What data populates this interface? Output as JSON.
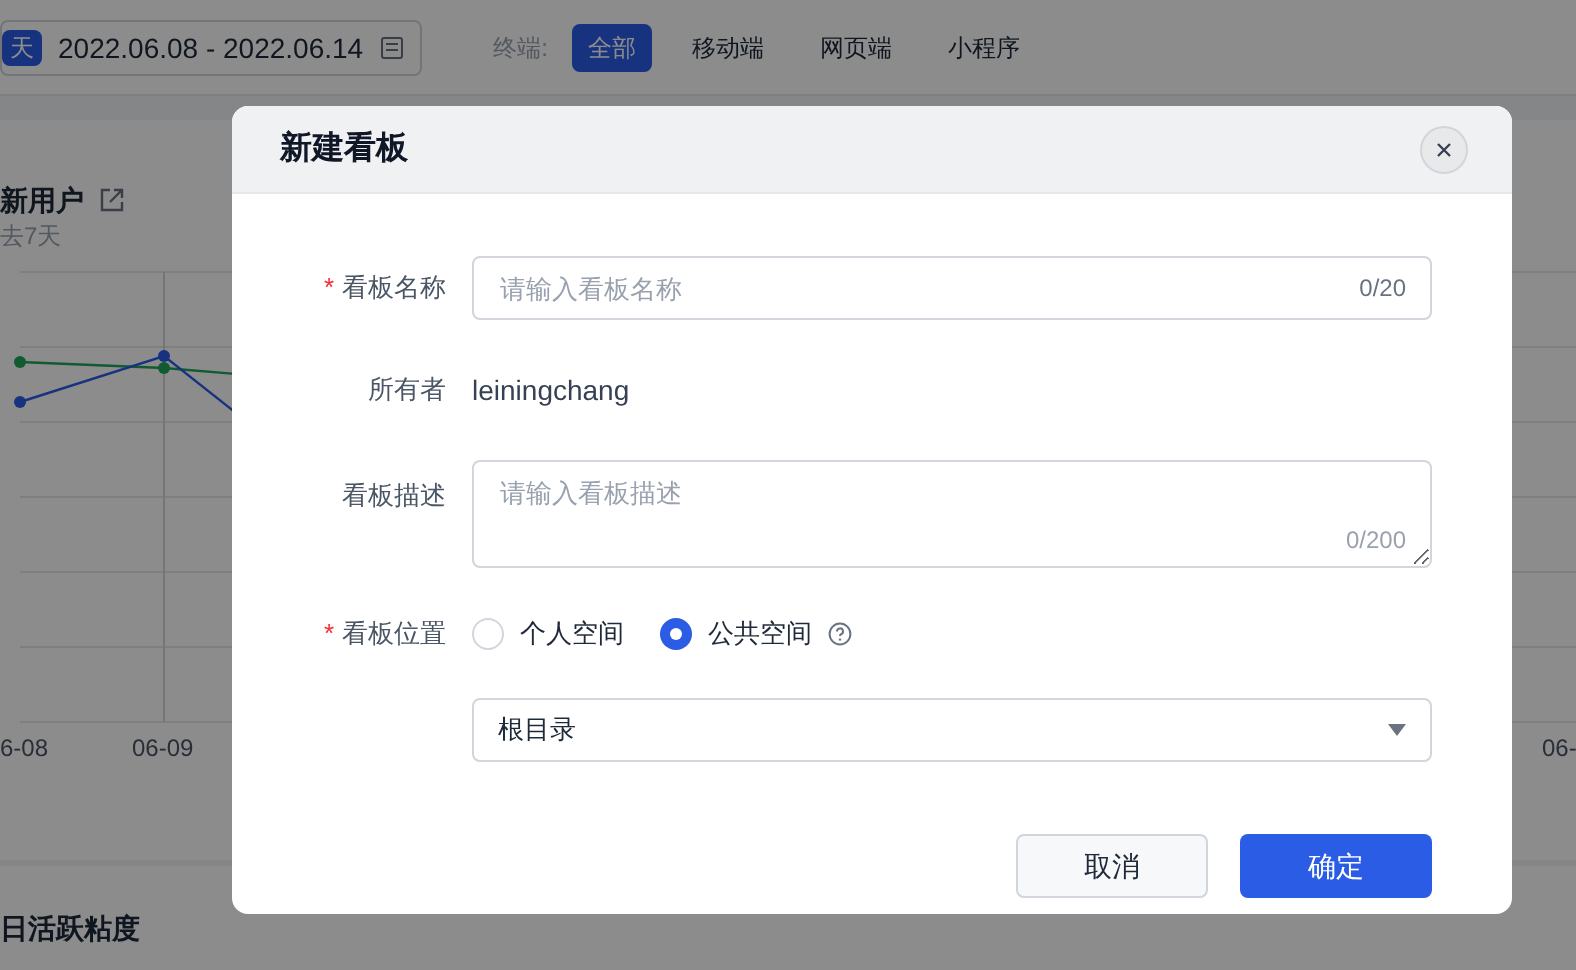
{
  "background": {
    "range_tag": "天",
    "date_range": "2022.06.08 - 2022.06.14",
    "terminal_label": "终端:",
    "terminals": [
      {
        "label": "全部",
        "selected": true
      },
      {
        "label": "移动端",
        "selected": false
      },
      {
        "label": "网页端",
        "selected": false
      },
      {
        "label": "小程序",
        "selected": false
      }
    ],
    "cards": [
      {
        "title": "新用户",
        "subtitle": "去7天",
        "x_labels": [
          "6-08",
          "06-09"
        ]
      },
      {
        "x_labels": [
          "06-"
        ]
      }
    ],
    "bottom_card": {
      "title": "日活跃粘度"
    }
  },
  "dialog": {
    "title": "新建看板",
    "fields": [
      {
        "kind": "text",
        "label": "看板名称",
        "required_mark": "*",
        "placeholder": "请输入看板名称",
        "counter": "0/20"
      },
      {
        "kind": "static",
        "label": "所有者",
        "value": "leiningchang"
      },
      {
        "kind": "textarea",
        "label": "看板描述",
        "placeholder": "请输入看板描述",
        "counter": "0/200"
      },
      {
        "kind": "radio",
        "label": "看板位置",
        "required_mark": "*",
        "options": [
          {
            "label": "个人空间",
            "selected": false,
            "help": false
          },
          {
            "label": "公共空间",
            "selected": true,
            "help": true
          }
        ]
      },
      {
        "kind": "select",
        "value": "根目录"
      }
    ],
    "buttons": [
      {
        "label": "取消",
        "kind": "secondary"
      },
      {
        "label": "确定",
        "kind": "primary"
      }
    ]
  }
}
